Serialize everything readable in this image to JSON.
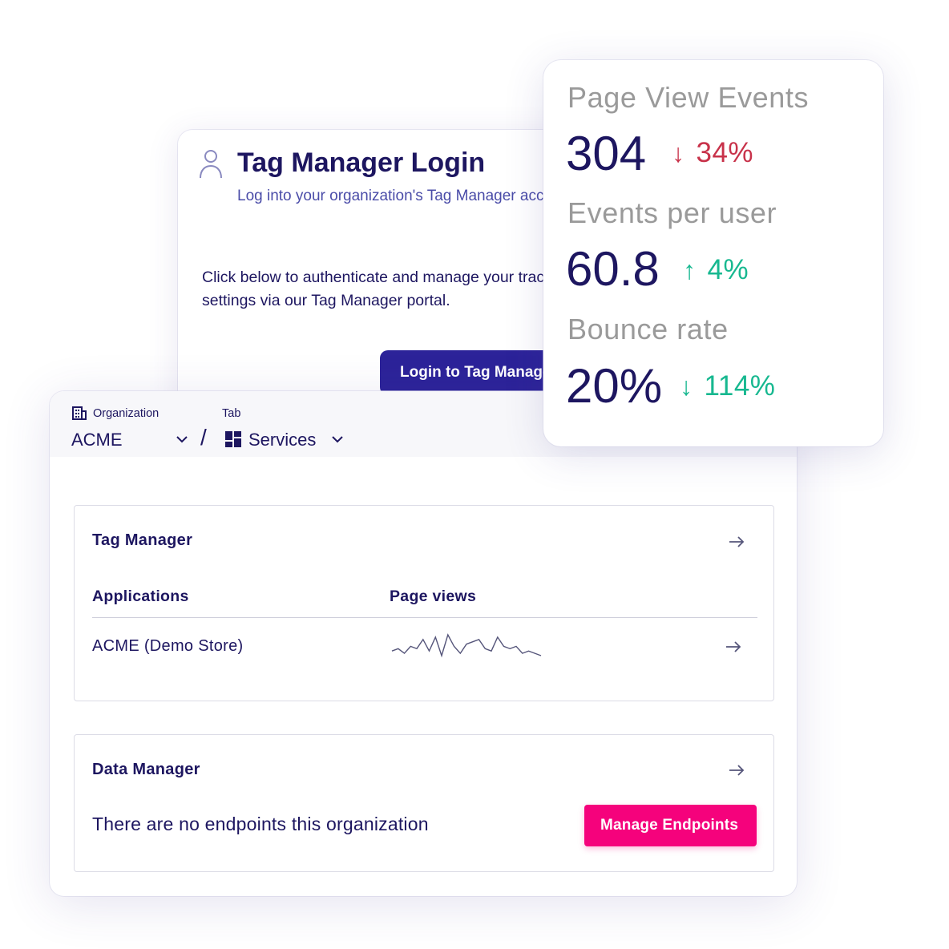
{
  "login": {
    "title": "Tag Manager Login",
    "subtitle": "Log into your organization's Tag Manager account.",
    "body": "Click below to authenticate and manage your tracking settings via our Tag Manager portal.",
    "button_label": "Login to Tag Manager",
    "icon": "user-icon"
  },
  "breadcrumb": {
    "organization_label": "Organization",
    "organization_value": "ACME",
    "separator": "/",
    "tab_label": "Tab",
    "tab_value": "Services",
    "organization_icon": "building-icon",
    "tab_icon": "grid-icon"
  },
  "tag_manager": {
    "title": "Tag Manager",
    "columns": [
      "Applications",
      "Page views"
    ],
    "rows": [
      {
        "name": "ACME (Demo Store)",
        "page_views_trend": [
          4,
          5,
          3,
          6,
          5,
          9,
          4,
          10,
          2,
          11,
          6,
          3,
          7,
          8,
          9,
          5,
          4,
          10,
          6,
          5,
          6,
          3,
          4,
          3,
          2
        ]
      }
    ]
  },
  "data_manager": {
    "title": "Data Manager",
    "empty_message": "There are no endpoints this organization",
    "button_label": "Manage Endpoints"
  },
  "stats": {
    "page_view_events": {
      "label": "Page View Events",
      "value": "304",
      "delta": "34%",
      "direction": "down"
    },
    "events_per_user": {
      "label": "Events per user",
      "value": "60.8",
      "delta": "4%",
      "direction": "up"
    },
    "bounce_rate": {
      "label": "Bounce rate",
      "value": "20%",
      "delta": "114%",
      "direction": "down"
    },
    "arrows": {
      "down": "↓",
      "up": "↑"
    }
  },
  "colors": {
    "primary": "#2c2399",
    "text": "#1d1660",
    "accent_pink": "#f5027c",
    "negative": "#c8324a",
    "positive": "#17b890",
    "label_gray": "#9a9a9a"
  }
}
